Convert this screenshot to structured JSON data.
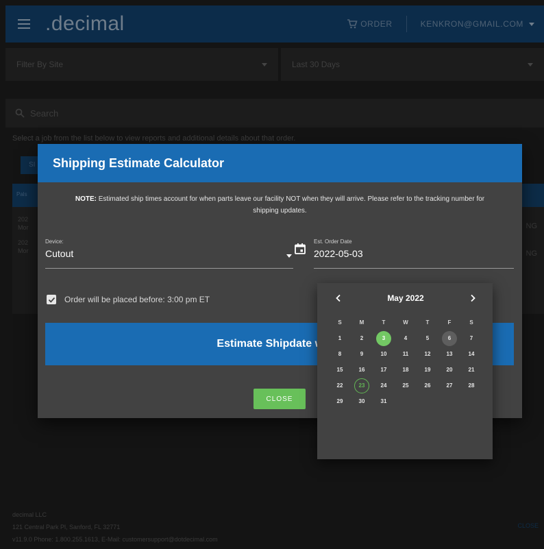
{
  "app": {
    "logo": ".decimal",
    "order_label": "ORDER",
    "user_email": "KENKRON@GMAIL.COM"
  },
  "filters": {
    "site_placeholder": "Filter By Site",
    "range_value": "Last 30 Days"
  },
  "search": {
    "placeholder": "Search"
  },
  "hint": "Select a job from the list below to view reports and additional details about that order.",
  "background_fragments": {
    "button_text": "SI",
    "table_head_text": "Pals",
    "row1_a": "202",
    "row1_b": "Mor",
    "row2_a": "202",
    "row2_b": "Mor",
    "right_1": "NG",
    "right_2": "NG"
  },
  "modal": {
    "title": "Shipping Estimate Calculator",
    "note_label": "NOTE:",
    "note_text": " Estimated ship times account for when parts leave our facility NOT when they will arrive. Please refer to the tracking number for shipping updates.",
    "device_label": "Device:",
    "device_value": "Cutout",
    "date_label": "Est. Order Date",
    "date_value": "2022-05-03",
    "checkbox_label": "Order will be placed before: 3:00 pm ET",
    "estimate_text": "Estimate Shipdate will b",
    "close_label": "CLOSE"
  },
  "datepicker": {
    "month_label": "May 2022",
    "weekdays": [
      "S",
      "M",
      "T",
      "W",
      "T",
      "F",
      "S"
    ],
    "weeks": [
      [
        "1",
        "2",
        "3",
        "4",
        "5",
        "6",
        "7"
      ],
      [
        "8",
        "9",
        "10",
        "11",
        "12",
        "13",
        "14"
      ],
      [
        "15",
        "16",
        "17",
        "18",
        "19",
        "20",
        "21"
      ],
      [
        "22",
        "23",
        "24",
        "25",
        "26",
        "27",
        "28"
      ],
      [
        "29",
        "30",
        "31",
        "",
        "",
        "",
        ""
      ]
    ],
    "selected_day": "3",
    "marked_day": "6",
    "today_day": "23"
  },
  "footer": {
    "company": "decimal LLC",
    "address": "121 Central Park Pl, Sanford, FL 32771",
    "contact": "v11.9.0 Phone: 1.800.255.1613, E-Mail: customersupport@dotdecimal.com",
    "right_text": "CLOSE"
  },
  "colors": {
    "primary": "#1a6cb3",
    "success": "#68c05a",
    "modal_bg": "#424242",
    "backdrop": "#141414"
  }
}
